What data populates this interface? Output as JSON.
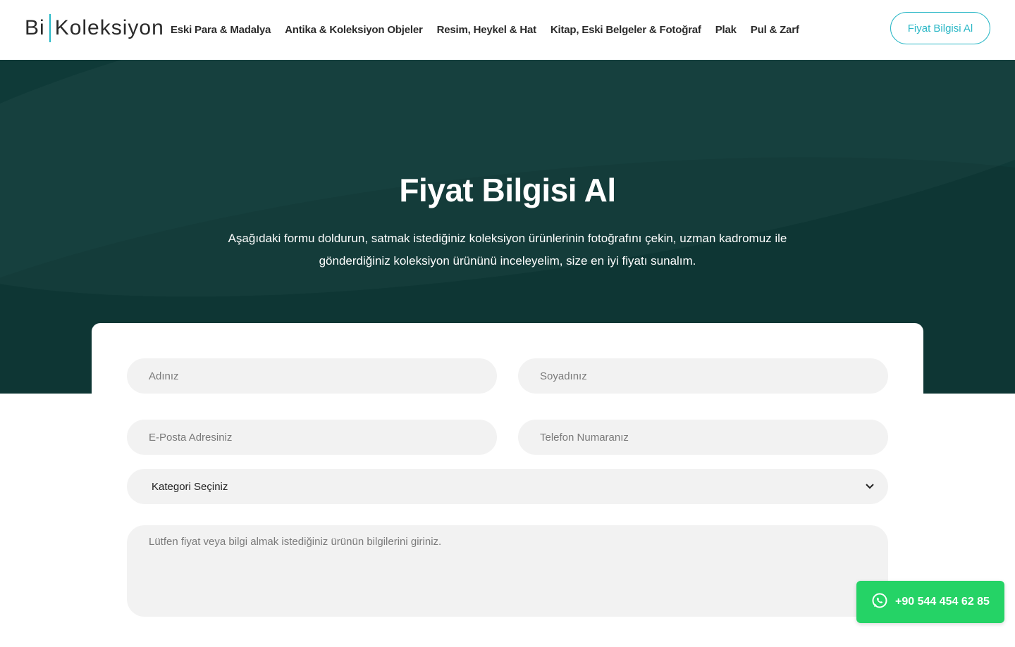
{
  "header": {
    "logo": {
      "part1": "Bi",
      "part2": "Koleksiyon"
    },
    "nav": [
      "Eski Para & Madalya",
      "Antika & Koleksiyon Objeler",
      "Resim, Heykel & Hat",
      "Kitap, Eski Belgeler & Fotoğraf",
      "Plak",
      "Pul & Zarf"
    ],
    "cta_label": "Fiyat Bilgisi Al"
  },
  "hero": {
    "title": "Fiyat Bilgisi Al",
    "description": "Aşağıdaki formu doldurun, satmak istediğiniz koleksiyon ürünlerinin fotoğrafını çekin, uzman kadromuz ile gönderdiğiniz koleksiyon ürününü inceleyelim, size en iyi fiyatı sunalım."
  },
  "form": {
    "first_name_placeholder": "Adınız",
    "last_name_placeholder": "Soyadınız",
    "email_placeholder": "E-Posta Adresiniz",
    "phone_placeholder": "Telefon Numaranız",
    "category_selected": "Kategori Seçiniz",
    "message_placeholder": "Lütfen fiyat veya bilgi almak istediğiniz ürünün bilgilerini giriniz."
  },
  "whatsapp": {
    "phone": "+90 544 454 62 85",
    "icon": "whatsapp-icon"
  },
  "colors": {
    "accent": "#2ab7c6",
    "hero_bg": "#0f3a38",
    "whatsapp": "#25d366",
    "field_bg": "#f2f2f2"
  }
}
